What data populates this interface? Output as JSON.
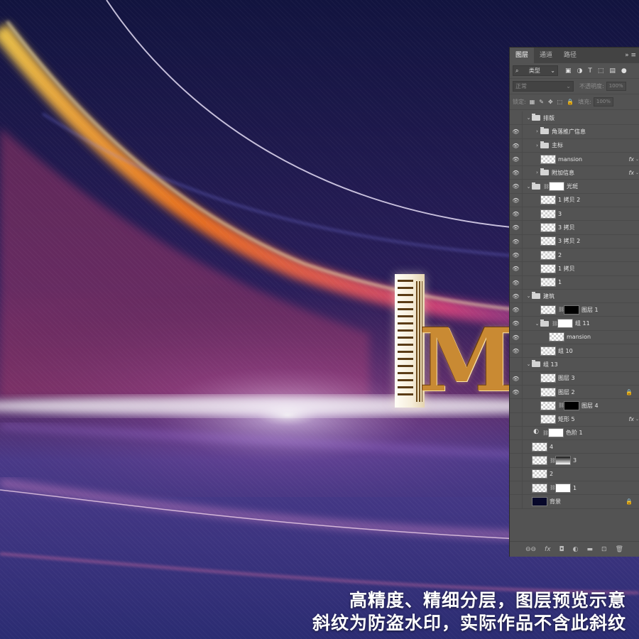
{
  "layers_panel": {
    "tabs": [
      {
        "label": "图层",
        "active": true
      },
      {
        "label": "通道",
        "active": false
      },
      {
        "label": "路径",
        "active": false
      }
    ],
    "tab_menu_glyphs": "» ≡",
    "filter_kind": "类型",
    "blend_mode": "正常",
    "opacity_label": "不透明度:",
    "opacity_value": "100%",
    "lock_label": "锁定:",
    "fill_label": "填充:",
    "fill_value": "100%",
    "layers": [
      {
        "name": "排版",
        "kind": "group",
        "indent": 0,
        "visible": false,
        "expanded": true
      },
      {
        "name": "角落推广信息",
        "kind": "group",
        "indent": 1,
        "visible": true,
        "expanded": false
      },
      {
        "name": "主标",
        "kind": "group",
        "indent": 1,
        "visible": true,
        "expanded": false
      },
      {
        "name": "mansion",
        "kind": "smart",
        "indent": 1,
        "visible": true,
        "right": "fx"
      },
      {
        "name": "附加信息",
        "kind": "group",
        "indent": 1,
        "visible": true,
        "expanded": false,
        "right": "fx"
      },
      {
        "name": "光斑",
        "kind": "group-mask",
        "indent": 0,
        "visible": true,
        "expanded": true
      },
      {
        "name": "1 拷贝 2",
        "kind": "pixel",
        "indent": 1,
        "visible": true
      },
      {
        "name": "3",
        "kind": "pixel",
        "indent": 1,
        "visible": true
      },
      {
        "name": "3 拷贝",
        "kind": "pixel",
        "indent": 1,
        "visible": true
      },
      {
        "name": "3 拷贝 2",
        "kind": "pixel",
        "indent": 1,
        "visible": true
      },
      {
        "name": "2",
        "kind": "pixel",
        "indent": 1,
        "visible": true
      },
      {
        "name": "1 拷贝",
        "kind": "pixel",
        "indent": 1,
        "visible": true
      },
      {
        "name": "1",
        "kind": "pixel",
        "indent": 1,
        "visible": true
      },
      {
        "name": "建筑",
        "kind": "group",
        "indent": 0,
        "visible": true,
        "expanded": true
      },
      {
        "name": "图层 1",
        "kind": "pixel-mask-black",
        "indent": 1,
        "visible": true
      },
      {
        "name": "组 11",
        "kind": "group-mask",
        "indent": 1,
        "visible": true,
        "expanded": true
      },
      {
        "name": "mansion",
        "kind": "pixel",
        "indent": 2,
        "visible": true
      },
      {
        "name": "组 10",
        "kind": "pixel",
        "indent": 1,
        "visible": true
      },
      {
        "name": "组 13",
        "kind": "group",
        "indent": 0,
        "visible": false,
        "expanded": true
      },
      {
        "name": "图层 3",
        "kind": "pixel",
        "indent": 1,
        "visible": true
      },
      {
        "name": "图层 2",
        "kind": "pixel",
        "indent": 1,
        "visible": true,
        "right": "lock"
      },
      {
        "name": "图层 4",
        "kind": "pixel-mask-black",
        "indent": 1,
        "visible": false
      },
      {
        "name": "矩形 5",
        "kind": "smart",
        "indent": 1,
        "visible": false,
        "right": "fx"
      },
      {
        "name": "色阶 1",
        "kind": "adjust-mask",
        "indent": 0,
        "visible": false
      },
      {
        "name": "4",
        "kind": "photo",
        "indent": 0,
        "visible": false
      },
      {
        "name": "3",
        "kind": "photo-mask-grad",
        "indent": 0,
        "visible": false
      },
      {
        "name": "2",
        "kind": "pixel",
        "indent": 0,
        "visible": false
      },
      {
        "name": "1",
        "kind": "pixel-mask",
        "indent": 0,
        "visible": false
      },
      {
        "name": "背景",
        "kind": "background",
        "indent": 0,
        "visible": false,
        "right": "lock"
      }
    ],
    "footer_icons": [
      "link-icon",
      "fx-icon",
      "mask-icon",
      "adjustment-icon",
      "folder-icon",
      "new-layer-icon",
      "trash-icon"
    ]
  },
  "artwork": {
    "letter": "M",
    "caption_line1": "高精度、精细分层，图层预览示意",
    "caption_line2": "斜纹为防盗水印，实际作品不含此斜纹"
  },
  "colors": {
    "panel_bg": "#535353",
    "panel_tabs_bg": "#434343",
    "bg_dark": "#141537",
    "glow_orange": "#ff7a1a",
    "glow_pink": "#e0457e",
    "gold": "#c98a33"
  }
}
